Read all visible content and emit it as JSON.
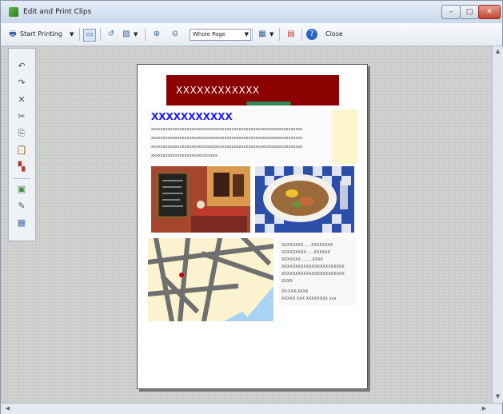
{
  "window": {
    "title": "Edit and Print Clips",
    "minimize_glyph": "–",
    "maximize_glyph": "□",
    "close_glyph": "✕"
  },
  "toolbar": {
    "start_printing_label": "Start Printing",
    "zoom_select_value": "Whole Page",
    "close_label": "Close",
    "icons": [
      "printer-icon",
      "page-view-icon",
      "rotate-icon",
      "image-icon",
      "zoom-in-icon",
      "zoom-out-icon",
      "layout-grid-icon",
      "print-preview-icon",
      "help-icon"
    ]
  },
  "sidebar": {
    "items": [
      {
        "icon": "undo-icon",
        "glyph": "↶"
      },
      {
        "icon": "redo-icon",
        "glyph": "↷"
      },
      {
        "icon": "delete-icon",
        "glyph": "✕"
      },
      {
        "icon": "cut-icon",
        "glyph": "✂"
      },
      {
        "icon": "copy-icon",
        "glyph": "⎘"
      },
      {
        "icon": "paste-icon",
        "glyph": "📋"
      },
      {
        "icon": "remove-clip-icon",
        "glyph": "▚"
      },
      {
        "icon": "add-clip-icon",
        "glyph": "▣"
      },
      {
        "icon": "edit-clip-icon",
        "glyph": "✎"
      },
      {
        "icon": "arrange-icon",
        "glyph": "▦"
      }
    ]
  },
  "page": {
    "banner_text": "XXXXXXXXXXXX",
    "headline": "XXXXXXXXXXX",
    "body_lines": [
      "xxxxxxxxxxxxxxxxxxxxxxxxxxxxxxxxxxxxxxxxxxxxxxxxxxxxxxxxxxxxxxxx",
      "xxxxxxxxxxxxxxxxxxxxxxxxxxxxxxxxxxxxxxxxxxxxxxxxxxxxxxxxxxxxxxxx",
      "xxxxxxxxxxxxxxxxxxxxxxxxxxxxxxxxxxxxxxxxxxxxxxxxxxxxxxxxxxxxxxxx",
      "xxxxxxxxxxxxxxxxxxxxxxxxxxxx"
    ],
    "info_lines": [
      "XXXXXXXX......XXXXXXXX",
      "XXXXXXXXX......XXXXXX",
      "XXXXXXX.........XXXX",
      "XXXXXXXXXXXXXXXXXXXXXXX",
      "XXXXXXXXXXXXXXXXXXXXXXX",
      "XXXX",
      "XX-XXX-XXXX",
      "XXXXX XXX XXXXXXXX xxx"
    ]
  },
  "colors": {
    "banner": "#8b0000",
    "headline": "#1a1aff",
    "accent_green": "#2e8b57"
  }
}
